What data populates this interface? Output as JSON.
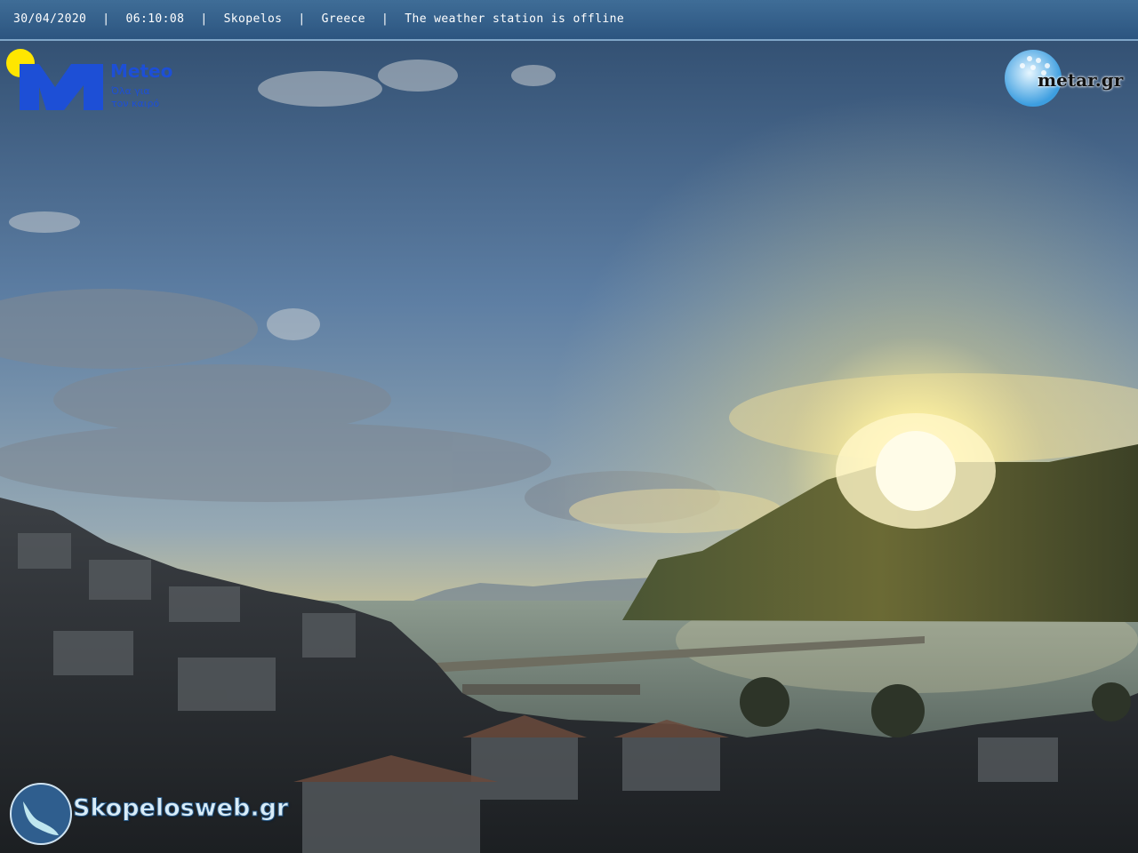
{
  "header": {
    "date": "30/04/2020",
    "time": "06:10:08",
    "location": "Skopelos",
    "country": "Greece",
    "status": "The weather station is offline",
    "separator": "|"
  },
  "logos": {
    "meteo": {
      "name": "Meteo",
      "tagline_line1": "Όλα για",
      "tagline_line2": "τον καιρό"
    },
    "metar": {
      "text": "metar.gr"
    },
    "skopelosweb": {
      "text": "Skopelosweb.gr"
    }
  },
  "colors": {
    "header_bar": "#2f5d8a",
    "meteo_blue": "#1d4fd6",
    "sun_yellow": "#ffe36a"
  }
}
